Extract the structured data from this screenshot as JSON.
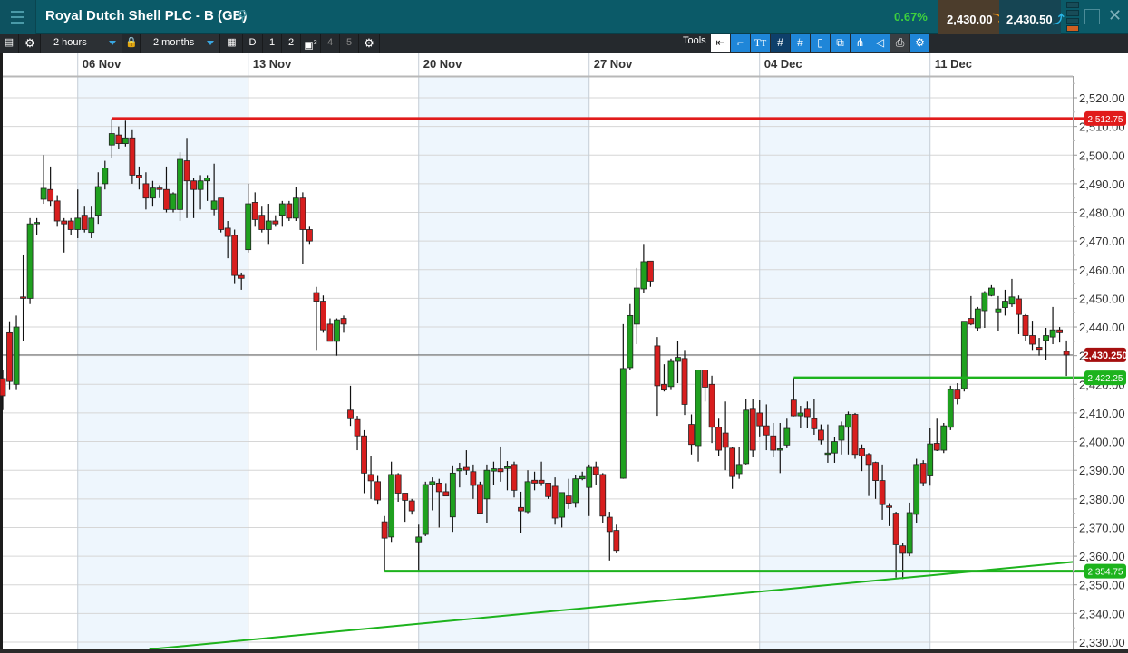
{
  "header": {
    "title": "Royal Dutch Shell PLC - B (GB)",
    "change": "0.67%",
    "sell_price": "2,430.00",
    "buy_price": "2,430.50",
    "change_color": "#3ed13e"
  },
  "toolbar": {
    "interval": "2 hours",
    "range": "2 months",
    "presets": [
      "D",
      "1",
      "2",
      "3",
      "4",
      "5"
    ],
    "tools_label": "Tools"
  },
  "chart_data": {
    "type": "candlestick",
    "title": "Royal Dutch Shell PLC - B (GB)",
    "interval": "2 hours",
    "ylim": [
      2327.5,
      2527
    ],
    "grid": true,
    "x_ticks": [
      {
        "label": "06 Nov",
        "index": 11
      },
      {
        "label": "13 Nov",
        "index": 36
      },
      {
        "label": "20 Nov",
        "index": 61
      },
      {
        "label": "27 Nov",
        "index": 86
      },
      {
        "label": "04 Dec",
        "index": 111
      },
      {
        "label": "11 Dec",
        "index": 136
      }
    ],
    "y_ticks": [
      {
        "value": 2520,
        "label": "2,520.00"
      },
      {
        "value": 2510,
        "label": "2,510.00"
      },
      {
        "value": 2500,
        "label": "2,500.00"
      },
      {
        "value": 2490,
        "label": "2,490.00"
      },
      {
        "value": 2480,
        "label": "2,480.00"
      },
      {
        "value": 2470,
        "label": "2,470.00"
      },
      {
        "value": 2460,
        "label": "2,460.00"
      },
      {
        "value": 2450,
        "label": "2,450.00"
      },
      {
        "value": 2440,
        "label": "2,440.00"
      },
      {
        "value": 2430,
        "label": "2,430.00"
      },
      {
        "value": 2420,
        "label": "2,420.00"
      },
      {
        "value": 2410,
        "label": "2,410.00"
      },
      {
        "value": 2400,
        "label": "2,400.00"
      },
      {
        "value": 2390,
        "label": "2,390.00"
      },
      {
        "value": 2380,
        "label": "2,380.00"
      },
      {
        "value": 2370,
        "label": "2,370.00"
      },
      {
        "value": 2360,
        "label": "2,360.00"
      },
      {
        "value": 2350,
        "label": "2,350.00"
      },
      {
        "value": 2340,
        "label": "2,340.00"
      },
      {
        "value": 2330,
        "label": "2,330.00"
      }
    ],
    "ohlc": [
      [
        2422,
        2425,
        2411,
        2416
      ],
      [
        2438,
        2442,
        2418,
        2421
      ],
      [
        2420,
        2444,
        2418,
        2440
      ],
      [
        2450.5,
        2465,
        2435,
        2450
      ],
      [
        2450,
        2478,
        2448,
        2476
      ],
      [
        2476,
        2478,
        2472,
        2476.5
      ],
      [
        2484.6,
        2500,
        2483,
        2488.4
      ],
      [
        2488,
        2496,
        2482,
        2484
      ],
      [
        2484,
        2486,
        2475,
        2477
      ],
      [
        2477,
        2478,
        2466,
        2476
      ],
      [
        2477,
        2478,
        2472,
        2474
      ],
      [
        2474,
        2488,
        2471,
        2478
      ],
      [
        2479,
        2482,
        2473,
        2474
      ],
      [
        2473,
        2482,
        2471,
        2478
      ],
      [
        2479,
        2494,
        2476,
        2489
      ],
      [
        2490,
        2498,
        2488,
        2495.5
      ],
      [
        2503.5,
        2512.75,
        2499,
        2507.5
      ],
      [
        2507,
        2510,
        2502,
        2504
      ],
      [
        2504,
        2512,
        2503,
        2506
      ],
      [
        2506,
        2509,
        2490,
        2493
      ],
      [
        2493,
        2496,
        2488,
        2492
      ],
      [
        2490,
        2494,
        2481,
        2485
      ],
      [
        2485,
        2491,
        2482,
        2488.5
      ],
      [
        2488.5,
        2489.5,
        2485,
        2488
      ],
      [
        2488,
        2496,
        2480,
        2481
      ],
      [
        2481,
        2487,
        2480,
        2486.5
      ],
      [
        2481,
        2501,
        2477,
        2498.5
      ],
      [
        2498,
        2506,
        2478,
        2491
      ],
      [
        2491,
        2492,
        2478,
        2488
      ],
      [
        2488,
        2493,
        2481,
        2491
      ],
      [
        2491,
        2493,
        2484,
        2492
      ],
      [
        2481,
        2497,
        2479,
        2484
      ],
      [
        2485,
        2485,
        2473,
        2474
      ],
      [
        2474.5,
        2477,
        2464,
        2471.6
      ],
      [
        2472,
        2474,
        2455,
        2458
      ],
      [
        2458,
        2459,
        2453,
        2457
      ],
      [
        2467,
        2490,
        2466,
        2483
      ],
      [
        2483.5,
        2487,
        2475,
        2477.5
      ],
      [
        2479,
        2482,
        2473,
        2474
      ],
      [
        2474,
        2483,
        2469,
        2477
      ],
      [
        2477,
        2479,
        2475,
        2476
      ],
      [
        2479,
        2484,
        2475,
        2483
      ],
      [
        2483,
        2484,
        2477,
        2478
      ],
      [
        2478,
        2489,
        2477,
        2485
      ],
      [
        2485,
        2487,
        2462,
        2474
      ],
      [
        2474,
        2475,
        2469,
        2470
      ],
      [
        2452,
        2454,
        2432,
        2449
      ],
      [
        2449,
        2451,
        2438,
        2439
      ],
      [
        2441,
        2443,
        2435,
        2435
      ],
      [
        2435,
        2443,
        2430,
        2442.5
      ],
      [
        2443,
        2444,
        2438,
        2441
      ],
      [
        2411,
        2419.5,
        2405.5,
        2408
      ],
      [
        2407.7,
        2409,
        2397,
        2402
      ],
      [
        2402,
        2404,
        2382,
        2389
      ],
      [
        2388.5,
        2395,
        2380,
        2386.3
      ],
      [
        2386,
        2388,
        2378,
        2379.6
      ],
      [
        2372,
        2374,
        2354.75,
        2366.3
      ],
      [
        2366.7,
        2393,
        2365,
        2388.5
      ],
      [
        2388.5,
        2389,
        2379,
        2382
      ],
      [
        2382,
        2382,
        2372,
        2379.5
      ],
      [
        2379.3,
        2380,
        2374.5,
        2375.8
      ],
      [
        2365,
        2371,
        2354.75,
        2366.7
      ],
      [
        2367.6,
        2386,
        2367,
        2385
      ],
      [
        2385,
        2387.5,
        2376,
        2386
      ],
      [
        2385.5,
        2387,
        2370,
        2382.5
      ],
      [
        2382.5,
        2385.5,
        2381,
        2381
      ],
      [
        2373.7,
        2391.7,
        2368.5,
        2389
      ],
      [
        2389.8,
        2392.6,
        2384,
        2390.5
      ],
      [
        2391,
        2397,
        2388.5,
        2390
      ],
      [
        2389.5,
        2392,
        2380,
        2384.7
      ],
      [
        2385,
        2386,
        2375,
        2375
      ],
      [
        2380,
        2392,
        2371.7,
        2390
      ],
      [
        2389.7,
        2393,
        2385,
        2390.5
      ],
      [
        2390.5,
        2398.3,
        2386,
        2389.5
      ],
      [
        2390.6,
        2393.2,
        2383,
        2391.2
      ],
      [
        2392,
        2393,
        2380.5,
        2383
      ],
      [
        2377,
        2382.5,
        2368,
        2375.8
      ],
      [
        2375.5,
        2390,
        2375,
        2386
      ],
      [
        2386.5,
        2389.5,
        2383,
        2385.5
      ],
      [
        2386.5,
        2393,
        2384.5,
        2385.5
      ],
      [
        2385.5,
        2385.5,
        2380,
        2380.8
      ],
      [
        2384.4,
        2387.5,
        2371,
        2373.3
      ],
      [
        2373.6,
        2382.2,
        2370,
        2382.2
      ],
      [
        2381,
        2387,
        2376.5,
        2378.5
      ],
      [
        2378.7,
        2388.4,
        2377,
        2387
      ],
      [
        2387,
        2389.5,
        2386.5,
        2387.8
      ],
      [
        2384,
        2392,
        2374,
        2391
      ],
      [
        2391,
        2393,
        2385,
        2388.5
      ],
      [
        2388.5,
        2389,
        2371.7,
        2374
      ],
      [
        2373.6,
        2375.5,
        2358.5,
        2368.6
      ],
      [
        2369,
        2371,
        2361,
        2362
      ],
      [
        2387.2,
        2441,
        2387,
        2425.5
      ],
      [
        2425.8,
        2448,
        2425,
        2444
      ],
      [
        2441,
        2460.6,
        2434,
        2453.6
      ],
      [
        2453.3,
        2469,
        2452,
        2462.8
      ],
      [
        2463,
        2463,
        2454,
        2456
      ],
      [
        2433.4,
        2436.5,
        2409,
        2419.5
      ],
      [
        2420,
        2427,
        2417.5,
        2418
      ],
      [
        2419.2,
        2429,
        2418,
        2428
      ],
      [
        2428,
        2435,
        2420.4,
        2429.4
      ],
      [
        2429,
        2432,
        2409.3,
        2413
      ],
      [
        2406,
        2409.5,
        2395.5,
        2399
      ],
      [
        2398.6,
        2425,
        2393,
        2425
      ],
      [
        2425,
        2425,
        2414,
        2419
      ],
      [
        2420,
        2423,
        2399.5,
        2405
      ],
      [
        2405,
        2408,
        2395,
        2397
      ],
      [
        2403,
        2414,
        2390,
        2398
      ],
      [
        2397.7,
        2398,
        2383.5,
        2387.8
      ],
      [
        2388.8,
        2398,
        2387,
        2392
      ],
      [
        2392.3,
        2415,
        2392,
        2411
      ],
      [
        2411.3,
        2415,
        2394.5,
        2397
      ],
      [
        2410,
        2414.4,
        2401.8,
        2405.5
      ],
      [
        2405.5,
        2413,
        2397,
        2402.3
      ],
      [
        2402,
        2406.5,
        2394.5,
        2397
      ],
      [
        2397,
        2406.5,
        2389,
        2397.5
      ],
      [
        2398.8,
        2408,
        2397.7,
        2404.6
      ],
      [
        2414.5,
        2422.25,
        2408.8,
        2409
      ],
      [
        2409,
        2412.5,
        2404.6,
        2410
      ],
      [
        2411.3,
        2414,
        2404.6,
        2408.7
      ],
      [
        2408,
        2415,
        2402.4,
        2404.5
      ],
      [
        2404,
        2406,
        2399,
        2400.5
      ],
      [
        2395.5,
        2406,
        2392.6,
        2396
      ],
      [
        2396,
        2401.5,
        2392.6,
        2400
      ],
      [
        2400.5,
        2407,
        2395.5,
        2405.6
      ],
      [
        2405,
        2410.5,
        2395.5,
        2409.5
      ],
      [
        2409.5,
        2410,
        2394,
        2395.5
      ],
      [
        2397.5,
        2399,
        2389.7,
        2395
      ],
      [
        2395.5,
        2396,
        2381,
        2392
      ],
      [
        2392.7,
        2393,
        2380,
        2386.4
      ],
      [
        2386.4,
        2392,
        2372.7,
        2378
      ],
      [
        2377.5,
        2378.5,
        2370.5,
        2377
      ],
      [
        2375,
        2375.5,
        2352.5,
        2364
      ],
      [
        2363.6,
        2364.5,
        2352,
        2361
      ],
      [
        2361,
        2378.7,
        2360,
        2375.2
      ],
      [
        2374.6,
        2394,
        2371.4,
        2392
      ],
      [
        2392.4,
        2393.5,
        2384.4,
        2385.6
      ],
      [
        2388,
        2404.6,
        2384.6,
        2399.2
      ],
      [
        2399.4,
        2408,
        2396.7,
        2397
      ],
      [
        2397,
        2406.5,
        2396,
        2405.5
      ],
      [
        2405,
        2419.5,
        2404,
        2418.2
      ],
      [
        2418,
        2420.4,
        2413,
        2415
      ],
      [
        2418.5,
        2442,
        2417.5,
        2442
      ],
      [
        2443,
        2450.8,
        2440.6,
        2441
      ],
      [
        2439.7,
        2447,
        2438.5,
        2446.3
      ],
      [
        2445.7,
        2452.5,
        2439.7,
        2452
      ],
      [
        2451,
        2454.6,
        2450.7,
        2453.6
      ],
      [
        2445,
        2450.8,
        2438.5,
        2446.3
      ],
      [
        2446.8,
        2453,
        2444,
        2449
      ],
      [
        2448,
        2456.8,
        2447,
        2450.5
      ],
      [
        2449.8,
        2451,
        2437.5,
        2444.4
      ],
      [
        2444,
        2444.5,
        2435,
        2437
      ],
      [
        2437,
        2442.2,
        2432,
        2434
      ],
      [
        2432.9,
        2436.2,
        2430,
        2432.2
      ],
      [
        2435.3,
        2439.7,
        2428.4,
        2437
      ],
      [
        2436.5,
        2447,
        2434,
        2439
      ],
      [
        2439,
        2440,
        2434.6,
        2438
      ],
      [
        2431.5,
        2435.3,
        2422.9,
        2430.25
      ]
    ],
    "up_color": "#1fa01f",
    "down_color": "#d81e1e",
    "current_price": {
      "value": 2430.25,
      "label": "2,430.250",
      "color": "#a50f0f"
    },
    "horizontal_lines": [
      {
        "value": 2512.75,
        "from_index": 16,
        "label": "2,512.75",
        "color": "#e11b1b"
      },
      {
        "value": 2422.25,
        "from_index": 116,
        "label": "2,422.25",
        "color": "#1db31d"
      },
      {
        "value": 2354.75,
        "from_index": 56,
        "label": "2,354.75",
        "color": "#1db31d"
      }
    ],
    "trendline": {
      "from": {
        "index": 21.5,
        "value": 2327.5
      },
      "to": {
        "index": 157,
        "value": 2358
      },
      "color": "#1db31d"
    }
  }
}
